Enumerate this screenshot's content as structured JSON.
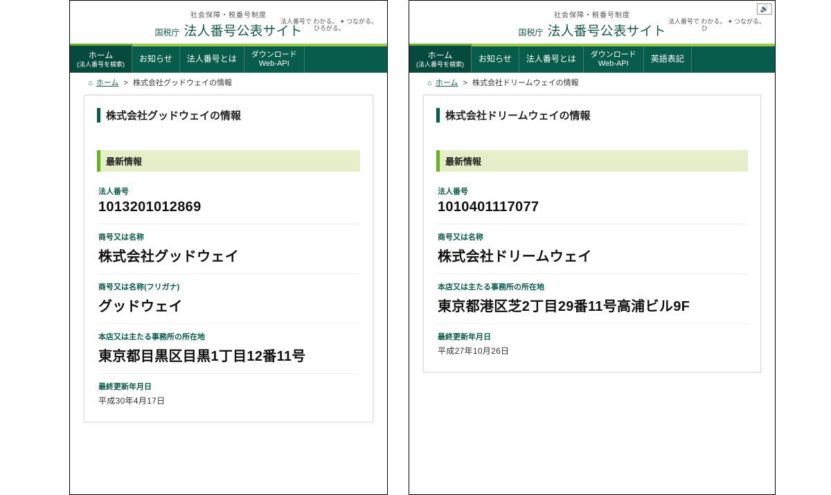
{
  "header": {
    "subtitle": "社会保障・税番号制度",
    "agency": "国税庁",
    "site_title": "法人番号公表サイト",
    "tagline_pre": "法人番号で",
    "tagline_wakaru": "わかる。",
    "tagline_tsunagaru": "つながる。",
    "tagline_hirogaru": "ひろがる。"
  },
  "nav": {
    "home_main": "ホーム",
    "home_sub": "(法人番号を検索)",
    "news": "お知らせ",
    "about": "法人番号とは",
    "download_main": "ダウンロード",
    "download_sub": "Web-API",
    "english": "英語表記"
  },
  "breadcrumb": {
    "home": "ホーム",
    "sep": ">"
  },
  "section_latest": "最新情報",
  "labels": {
    "number": "法人番号",
    "name": "商号又は名称",
    "kana": "商号又は名称(フリガナ)",
    "address": "本店又は主たる事務所の所在地",
    "updated": "最終更新年月日"
  },
  "panels": [
    {
      "breadcrumb_current": "株式会社グッドウェイの情報",
      "card_title": "株式会社グッドウェイの情報",
      "number": "1013201012869",
      "name": "株式会社グッドウェイ",
      "kana": "グッドウェイ",
      "address": "東京都目黒区目黒1丁目12番11号",
      "updated": "平成30年4月17日"
    },
    {
      "breadcrumb_current": "株式会社ドリームウェイの情報",
      "card_title": "株式会社ドリームウェイの情報",
      "number": "1010401117077",
      "name": "株式会社ドリームウェイ",
      "address": "東京都港区芝2丁目29番11号高浦ビル9F",
      "updated": "平成27年10月26日"
    }
  ]
}
